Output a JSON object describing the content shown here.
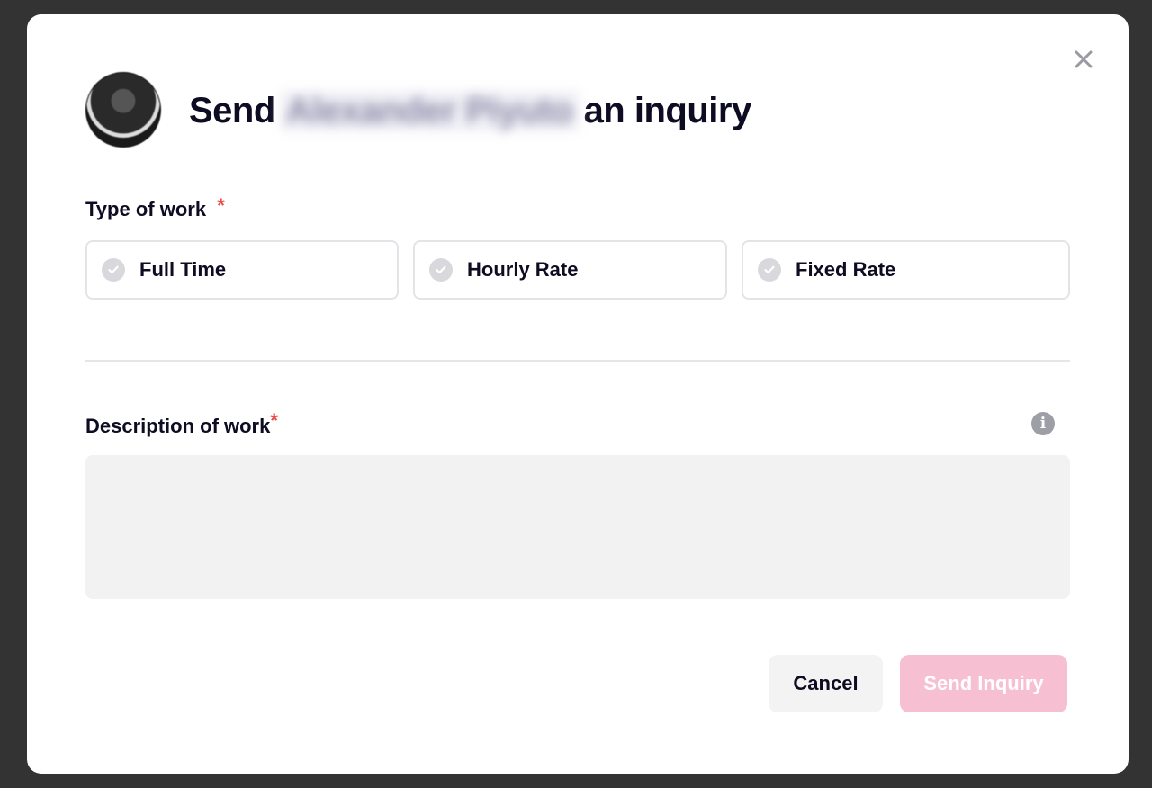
{
  "modal": {
    "title_prefix": "Send",
    "recipient_name": "Alexander Piyuto",
    "title_suffix": "an inquiry",
    "close_icon": "close-icon",
    "avatar": "avatar"
  },
  "type_of_work": {
    "label": "Type of work",
    "required_mark": "*",
    "options": [
      {
        "label": "Full Time"
      },
      {
        "label": "Hourly Rate"
      },
      {
        "label": "Fixed Rate"
      }
    ]
  },
  "description": {
    "label": "Description of work",
    "required_mark": "*",
    "info_icon": "info-icon",
    "value": "",
    "placeholder": ""
  },
  "actions": {
    "cancel_label": "Cancel",
    "send_label": "Send Inquiry"
  },
  "colors": {
    "accent_disabled": "#f7bfd2",
    "required": "#ea4c4c",
    "text": "#0d0c22"
  }
}
